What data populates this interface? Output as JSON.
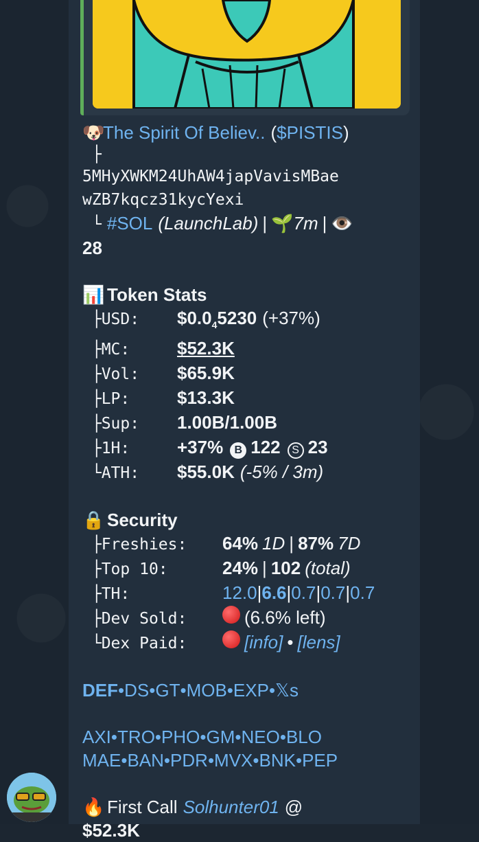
{
  "token": {
    "emoji": "🐶",
    "name": "The Spirit Of Believ..",
    "ticker": "$PISTIS",
    "address_line1": "5MHyXWKM24UhAW4japVavisMBae",
    "address_line2": "wZB7kqcz31kycYexi",
    "chain": "#SOL",
    "platform": "(LaunchLab)",
    "age": "7m",
    "views": "28"
  },
  "stats": {
    "title": "Token Stats",
    "usd_label": "USD:",
    "usd_value": "$0.0",
    "usd_sub": "4",
    "usd_rest": "5230",
    "usd_change": "(+37%)",
    "mc_label": "MC:",
    "mc_value": "$52.3K",
    "vol_label": "Vol:",
    "vol_value": "$65.9K",
    "lp_label": "LP:",
    "lp_value": "$13.3K",
    "sup_label": "Sup:",
    "sup_value": "1.00B/1.00B",
    "h1_label": "1H:",
    "h1_change": "+37%",
    "h1_buys_icon": "B",
    "h1_buys": "122",
    "h1_sells_icon": "S",
    "h1_sells": "23",
    "ath_label": "ATH:",
    "ath_value": "$55.0K",
    "ath_detail": "(-5% / 3m)"
  },
  "security": {
    "title": "Security",
    "fresh_label": "Freshies:",
    "fresh_1d": "64%",
    "fresh_1d_unit": "1D",
    "fresh_7d": "87%",
    "fresh_7d_unit": "7D",
    "top10_label": "Top 10:",
    "top10_pct": "24%",
    "top10_count": "102",
    "top10_total": "(total)",
    "th_label": "TH:",
    "th_values": [
      "12.0",
      "6.6",
      "0.7",
      "0.7",
      "0.7"
    ],
    "dev_label": "Dev Sold:",
    "dev_value": "(6.6% left)",
    "dex_label": "Dex Paid:",
    "dex_info": "[info]",
    "dex_lens": "[lens]"
  },
  "links_row1": [
    "DEF",
    "DS",
    "GT",
    "MOB",
    "EXP",
    "𝕏s"
  ],
  "links_row2": [
    "AXI",
    "TRO",
    "PHO",
    "GM",
    "NEO",
    "BLO"
  ],
  "links_row3": [
    "MAE",
    "BAN",
    "PDR",
    "MVX",
    "BNK",
    "PEP"
  ],
  "first_call": {
    "emoji": "🔥",
    "label": "First Call",
    "user": "Solhunter01",
    "at": "@",
    "value": "$52.3K"
  },
  "colors": {
    "link": "#6fb3ef",
    "bubble": "#222f3d",
    "accent_bar": "#5fae5a",
    "preview_bg": "#f6c91d"
  }
}
